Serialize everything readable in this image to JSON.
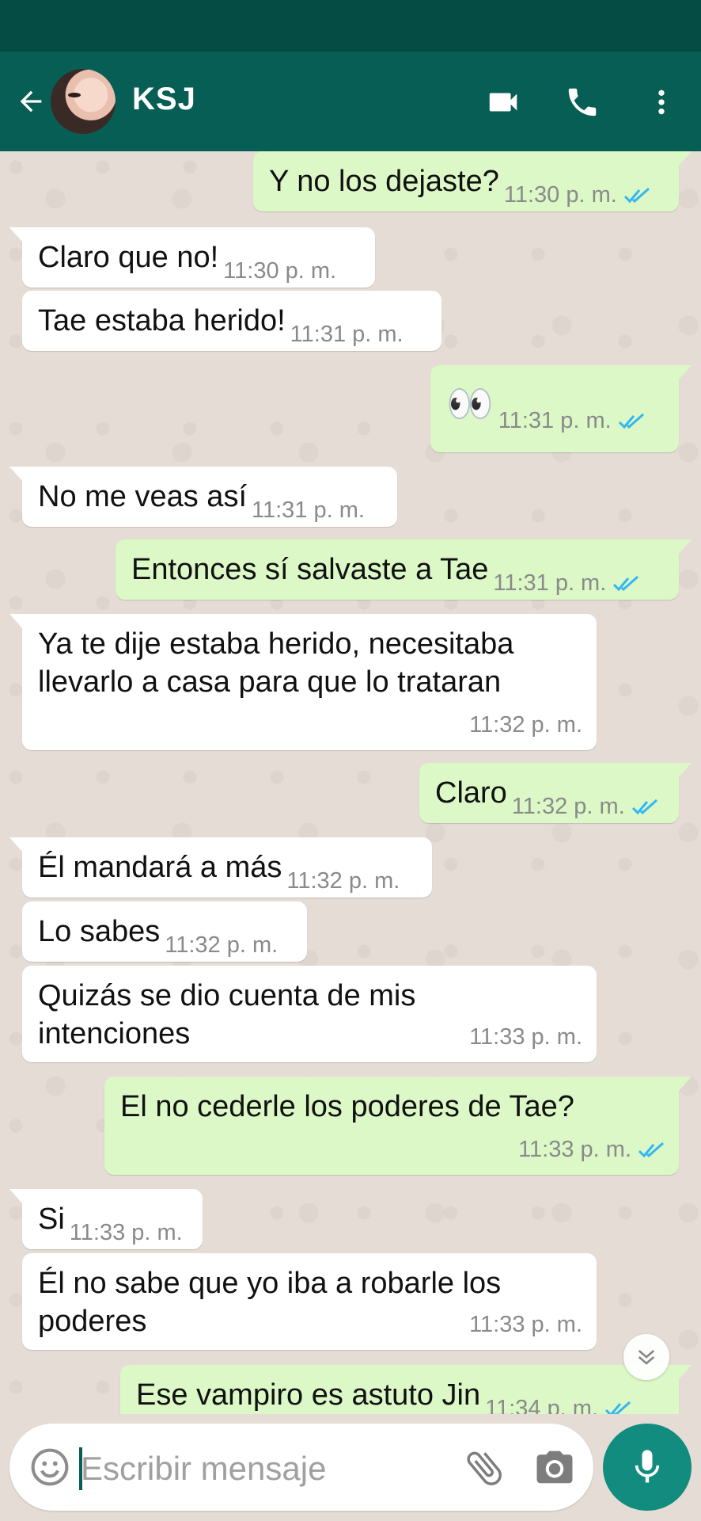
{
  "header": {
    "contact_name": "KSJ"
  },
  "icons": {
    "back": "arrow-left-icon",
    "video": "video-camera-icon",
    "call": "phone-icon",
    "menu": "more-vertical-icon",
    "emoji": "emoji-icon",
    "attach": "paperclip-icon",
    "camera": "camera-icon",
    "mic": "microphone-icon",
    "scroll": "chevron-double-down-icon"
  },
  "colors": {
    "header": "#075e54",
    "status_bar": "#054d44",
    "outgoing_bubble": "#dcf8c6",
    "incoming_bubble": "#ffffff",
    "read_ticks": "#34b7f1",
    "mic_button": "#128c7e"
  },
  "messages": [
    {
      "dir": "out",
      "text": "Y no los dejaste?",
      "time": "11:30 p. m.",
      "read": true
    },
    {
      "dir": "in",
      "text": "Claro que no!",
      "time": "11:30 p. m."
    },
    {
      "dir": "in",
      "text": "Tae estaba herido!",
      "time": "11:31 p. m."
    },
    {
      "dir": "out",
      "text": "👀",
      "time": "11:31 p. m.",
      "read": true
    },
    {
      "dir": "in",
      "text": "No me veas así",
      "time": "11:31 p. m."
    },
    {
      "dir": "out",
      "text": "Entonces sí salvaste a Tae",
      "time": "11:31 p. m.",
      "read": true
    },
    {
      "dir": "in",
      "text": "Ya te dije estaba herido, necesitaba\nllevarlo a casa para que lo trataran",
      "time": "11:32 p. m."
    },
    {
      "dir": "out",
      "text": "Claro",
      "time": "11:32 p. m.",
      "read": true
    },
    {
      "dir": "in",
      "text": "Él mandará a más",
      "time": "11:32 p. m."
    },
    {
      "dir": "in",
      "text": "Lo sabes",
      "time": "11:32 p. m."
    },
    {
      "dir": "in",
      "text": "Quizás se dio cuenta de mis\nintenciones",
      "time": "11:33 p. m."
    },
    {
      "dir": "out",
      "text": "El no cederle los poderes de Tae?",
      "time": "11:33 p. m.",
      "read": true
    },
    {
      "dir": "in",
      "text": "Si",
      "time": "11:33 p. m."
    },
    {
      "dir": "in",
      "text": "Él no sabe que yo iba a robarle los\npoderes",
      "time": "11:33 p. m."
    },
    {
      "dir": "out",
      "text": "Ese vampiro es astuto Jin",
      "time": "11:34 p. m.",
      "read": true
    }
  ],
  "composer": {
    "placeholder": "Escribir mensaje"
  }
}
